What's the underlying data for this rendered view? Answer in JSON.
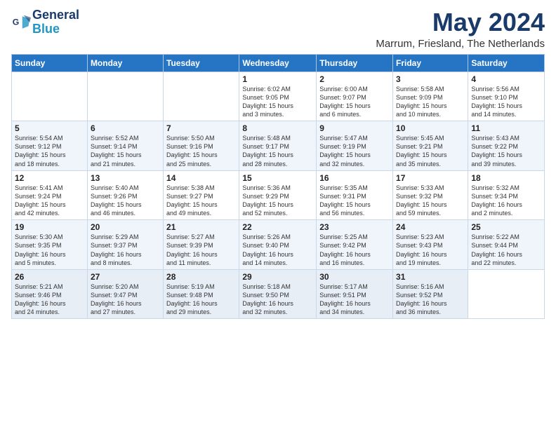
{
  "header": {
    "logo_line1": "General",
    "logo_line2": "Blue",
    "month_title": "May 2024",
    "location": "Marrum, Friesland, The Netherlands"
  },
  "calendar": {
    "days_of_week": [
      "Sunday",
      "Monday",
      "Tuesday",
      "Wednesday",
      "Thursday",
      "Friday",
      "Saturday"
    ],
    "weeks": [
      [
        {
          "num": "",
          "info": ""
        },
        {
          "num": "",
          "info": ""
        },
        {
          "num": "",
          "info": ""
        },
        {
          "num": "1",
          "info": "Sunrise: 6:02 AM\nSunset: 9:05 PM\nDaylight: 15 hours\nand 3 minutes."
        },
        {
          "num": "2",
          "info": "Sunrise: 6:00 AM\nSunset: 9:07 PM\nDaylight: 15 hours\nand 6 minutes."
        },
        {
          "num": "3",
          "info": "Sunrise: 5:58 AM\nSunset: 9:09 PM\nDaylight: 15 hours\nand 10 minutes."
        },
        {
          "num": "4",
          "info": "Sunrise: 5:56 AM\nSunset: 9:10 PM\nDaylight: 15 hours\nand 14 minutes."
        }
      ],
      [
        {
          "num": "5",
          "info": "Sunrise: 5:54 AM\nSunset: 9:12 PM\nDaylight: 15 hours\nand 18 minutes."
        },
        {
          "num": "6",
          "info": "Sunrise: 5:52 AM\nSunset: 9:14 PM\nDaylight: 15 hours\nand 21 minutes."
        },
        {
          "num": "7",
          "info": "Sunrise: 5:50 AM\nSunset: 9:16 PM\nDaylight: 15 hours\nand 25 minutes."
        },
        {
          "num": "8",
          "info": "Sunrise: 5:48 AM\nSunset: 9:17 PM\nDaylight: 15 hours\nand 28 minutes."
        },
        {
          "num": "9",
          "info": "Sunrise: 5:47 AM\nSunset: 9:19 PM\nDaylight: 15 hours\nand 32 minutes."
        },
        {
          "num": "10",
          "info": "Sunrise: 5:45 AM\nSunset: 9:21 PM\nDaylight: 15 hours\nand 35 minutes."
        },
        {
          "num": "11",
          "info": "Sunrise: 5:43 AM\nSunset: 9:22 PM\nDaylight: 15 hours\nand 39 minutes."
        }
      ],
      [
        {
          "num": "12",
          "info": "Sunrise: 5:41 AM\nSunset: 9:24 PM\nDaylight: 15 hours\nand 42 minutes."
        },
        {
          "num": "13",
          "info": "Sunrise: 5:40 AM\nSunset: 9:26 PM\nDaylight: 15 hours\nand 46 minutes."
        },
        {
          "num": "14",
          "info": "Sunrise: 5:38 AM\nSunset: 9:27 PM\nDaylight: 15 hours\nand 49 minutes."
        },
        {
          "num": "15",
          "info": "Sunrise: 5:36 AM\nSunset: 9:29 PM\nDaylight: 15 hours\nand 52 minutes."
        },
        {
          "num": "16",
          "info": "Sunrise: 5:35 AM\nSunset: 9:31 PM\nDaylight: 15 hours\nand 56 minutes."
        },
        {
          "num": "17",
          "info": "Sunrise: 5:33 AM\nSunset: 9:32 PM\nDaylight: 15 hours\nand 59 minutes."
        },
        {
          "num": "18",
          "info": "Sunrise: 5:32 AM\nSunset: 9:34 PM\nDaylight: 16 hours\nand 2 minutes."
        }
      ],
      [
        {
          "num": "19",
          "info": "Sunrise: 5:30 AM\nSunset: 9:35 PM\nDaylight: 16 hours\nand 5 minutes."
        },
        {
          "num": "20",
          "info": "Sunrise: 5:29 AM\nSunset: 9:37 PM\nDaylight: 16 hours\nand 8 minutes."
        },
        {
          "num": "21",
          "info": "Sunrise: 5:27 AM\nSunset: 9:39 PM\nDaylight: 16 hours\nand 11 minutes."
        },
        {
          "num": "22",
          "info": "Sunrise: 5:26 AM\nSunset: 9:40 PM\nDaylight: 16 hours\nand 14 minutes."
        },
        {
          "num": "23",
          "info": "Sunrise: 5:25 AM\nSunset: 9:42 PM\nDaylight: 16 hours\nand 16 minutes."
        },
        {
          "num": "24",
          "info": "Sunrise: 5:23 AM\nSunset: 9:43 PM\nDaylight: 16 hours\nand 19 minutes."
        },
        {
          "num": "25",
          "info": "Sunrise: 5:22 AM\nSunset: 9:44 PM\nDaylight: 16 hours\nand 22 minutes."
        }
      ],
      [
        {
          "num": "26",
          "info": "Sunrise: 5:21 AM\nSunset: 9:46 PM\nDaylight: 16 hours\nand 24 minutes."
        },
        {
          "num": "27",
          "info": "Sunrise: 5:20 AM\nSunset: 9:47 PM\nDaylight: 16 hours\nand 27 minutes."
        },
        {
          "num": "28",
          "info": "Sunrise: 5:19 AM\nSunset: 9:48 PM\nDaylight: 16 hours\nand 29 minutes."
        },
        {
          "num": "29",
          "info": "Sunrise: 5:18 AM\nSunset: 9:50 PM\nDaylight: 16 hours\nand 32 minutes."
        },
        {
          "num": "30",
          "info": "Sunrise: 5:17 AM\nSunset: 9:51 PM\nDaylight: 16 hours\nand 34 minutes."
        },
        {
          "num": "31",
          "info": "Sunrise: 5:16 AM\nSunset: 9:52 PM\nDaylight: 16 hours\nand 36 minutes."
        },
        {
          "num": "",
          "info": ""
        }
      ]
    ]
  }
}
